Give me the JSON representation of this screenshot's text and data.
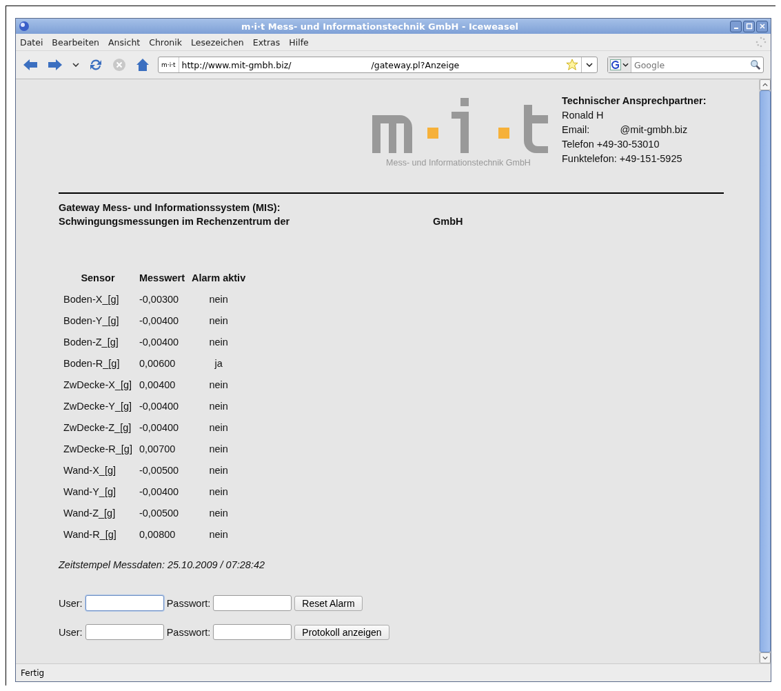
{
  "window": {
    "title": "m·i·t Mess- und Informationstechnik GmbH - Iceweasel"
  },
  "menu": [
    "Datei",
    "Bearbeiten",
    "Ansicht",
    "Chronik",
    "Lesezeichen",
    "Extras",
    "Hilfe"
  ],
  "toolbar": {
    "url_badge": "m·i·t",
    "url_left": "http://www.mit-gmbh.biz/",
    "url_right": "/gateway.pl?Anzeige",
    "search_placeholder": "Google"
  },
  "logo": {
    "subtitle": "Mess- und Informationstechnik GmbH"
  },
  "contact": {
    "heading": "Technischer Ansprechpartner:",
    "lines": [
      "Ronald H",
      "Email:           @mit-gmbh.biz",
      "Telefon +49-30-53010",
      "Funktelefon: +49-151-5925"
    ]
  },
  "heading": {
    "line1": "Gateway Mess- und Informationssystem (MIS):",
    "line2_left": "Schwingungsmessungen im Rechenzentrum der",
    "line2_right": "GmbH"
  },
  "table": {
    "columns": [
      "Sensor",
      "Messwert",
      "Alarm aktiv"
    ],
    "rows": [
      {
        "sensor": "Boden-X_[g]",
        "value": "-0,00300",
        "alarm": "nein"
      },
      {
        "sensor": "Boden-Y_[g]",
        "value": "-0,00400",
        "alarm": "nein"
      },
      {
        "sensor": "Boden-Z_[g]",
        "value": "-0,00400",
        "alarm": "nein"
      },
      {
        "sensor": "Boden-R_[g]",
        "value": "0,00600",
        "alarm": "ja"
      },
      {
        "sensor": "ZwDecke-X_[g]",
        "value": "0,00400",
        "alarm": "nein"
      },
      {
        "sensor": "ZwDecke-Y_[g]",
        "value": "-0,00400",
        "alarm": "nein"
      },
      {
        "sensor": "ZwDecke-Z_[g]",
        "value": "-0,00400",
        "alarm": "nein"
      },
      {
        "sensor": "ZwDecke-R_[g]",
        "value": "0,00700",
        "alarm": "nein"
      },
      {
        "sensor": "Wand-X_[g]",
        "value": "-0,00500",
        "alarm": "nein"
      },
      {
        "sensor": "Wand-Y_[g]",
        "value": "-0,00400",
        "alarm": "nein"
      },
      {
        "sensor": "Wand-Z_[g]",
        "value": "-0,00500",
        "alarm": "nein"
      },
      {
        "sensor": "Wand-R_[g]",
        "value": "0,00800",
        "alarm": "nein"
      }
    ]
  },
  "timestamp": "Zeitstempel Messdaten: 25.10.2009 / 07:28:42",
  "forms": [
    {
      "user_label": "User:",
      "user_focused": true,
      "password_label": "Passwort:",
      "button": "Reset Alarm"
    },
    {
      "user_label": "User:",
      "user_focused": false,
      "password_label": "Passwort:",
      "button": "Protokoll anzeigen"
    }
  ],
  "status_bar": "Fertig"
}
